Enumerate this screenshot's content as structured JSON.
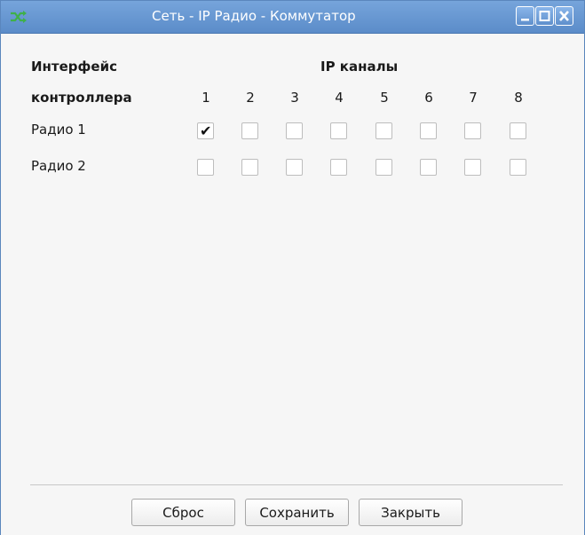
{
  "window": {
    "title": "Сеть - IP Радио - Коммутатор",
    "icon": "shuffle-icon"
  },
  "header": {
    "col1_line1": "Интерфейс",
    "col1_line2": "контроллера",
    "group_title": "IP каналы",
    "channels": [
      "1",
      "2",
      "3",
      "4",
      "5",
      "6",
      "7",
      "8"
    ]
  },
  "rows": [
    {
      "label": "Радио 1",
      "checked": [
        true,
        false,
        false,
        false,
        false,
        false,
        false,
        false
      ]
    },
    {
      "label": "Радио 2",
      "checked": [
        false,
        false,
        false,
        false,
        false,
        false,
        false,
        false
      ]
    }
  ],
  "buttons": {
    "reset": "Сброс",
    "save": "Сохранить",
    "close": "Закрыть"
  }
}
